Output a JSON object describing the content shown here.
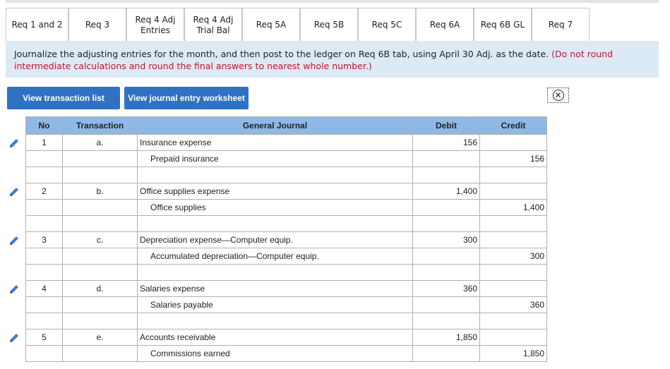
{
  "tabs": [
    {
      "label1": "Req 1 and 2",
      "label2": ""
    },
    {
      "label1": "Req 3",
      "label2": ""
    },
    {
      "label1": "Req 4 Adj",
      "label2": "Entries"
    },
    {
      "label1": "Req 4 Adj",
      "label2": "Trial Bal"
    },
    {
      "label1": "Req 5A",
      "label2": ""
    },
    {
      "label1": "Req 5B",
      "label2": ""
    },
    {
      "label1": "Req 5C",
      "label2": ""
    },
    {
      "label1": "Req 6A",
      "label2": ""
    },
    {
      "label1": "Req 6B GL",
      "label2": ""
    },
    {
      "label1": "Req 7",
      "label2": ""
    }
  ],
  "instructions": {
    "text": "Journalize the adjusting entries for the month, and then post to the ledger on Req 6B tab, using April 30 Adj. as the date.",
    "note": "(Do not round intermediate calculations and round the final answers to nearest whole number.)"
  },
  "buttons": {
    "view_transactions": "View transaction list",
    "view_journal": "View journal entry worksheet"
  },
  "table": {
    "headers": {
      "no": "No",
      "transaction": "Transaction",
      "general_journal": "General Journal",
      "debit": "Debit",
      "credit": "Credit"
    },
    "entries": [
      {
        "no": "1",
        "transaction": "a.",
        "debit_account": "Insurance expense",
        "credit_account": "Prepaid insurance",
        "amount_debit": "156",
        "amount_credit": "156"
      },
      {
        "no": "2",
        "transaction": "b.",
        "debit_account": "Office supplies expense",
        "credit_account": "Office supplies",
        "amount_debit": "1,400",
        "amount_credit": "1,400"
      },
      {
        "no": "3",
        "transaction": "c.",
        "debit_account": "Depreciation expense—Computer equip.",
        "credit_account": "Accumulated depreciation—Computer equip.",
        "amount_debit": "300",
        "amount_credit": "300"
      },
      {
        "no": "4",
        "transaction": "d.",
        "debit_account": "Salaries expense",
        "credit_account": "Salaries payable",
        "amount_debit": "360",
        "amount_credit": "360"
      },
      {
        "no": "5",
        "transaction": "e.",
        "debit_account": "Accounts receivable",
        "credit_account": "Commissions earned",
        "amount_debit": "1,850",
        "amount_credit": "1,850"
      }
    ]
  },
  "colors": {
    "header_bg": "#8fb8e6",
    "banner_bg": "#dceaf6",
    "button_bg": "#2f72c4",
    "note_red": "#c8102e"
  }
}
